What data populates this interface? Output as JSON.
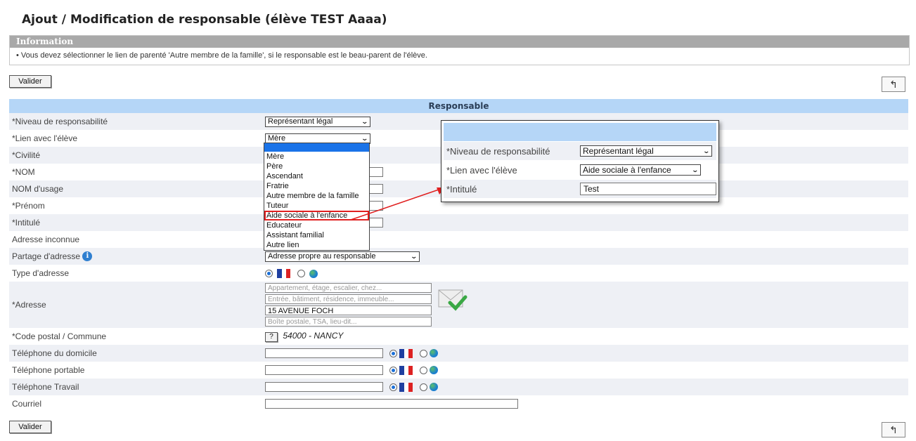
{
  "page": {
    "title": "Ajout / Modification de responsable (élève TEST Aaaa)"
  },
  "info": {
    "header": "Information",
    "text": "• Vous devez sélectionner le lien de parenté 'Autre membre de la famille', si le responsable est le beau-parent de l'élève."
  },
  "buttons": {
    "validate": "Valider",
    "back": "↰"
  },
  "form": {
    "header": "Responsable",
    "labels": {
      "niveau": "*Niveau de responsabilité",
      "lien": "*Lien avec l'élève",
      "civilite": "*Civilité",
      "nom": "*NOM",
      "nom_usage": "NOM d'usage",
      "prenom": "*Prénom",
      "intitule": "*Intitulé",
      "adresse_inconnue": "Adresse inconnue",
      "partage": "Partage d'adresse",
      "type_adresse": "Type d'adresse",
      "adresse": "*Adresse",
      "code_postal": "*Code postal / Commune",
      "tel_domicile": "Téléphone du domicile",
      "tel_portable": "Téléphone portable",
      "tel_travail": "Téléphone Travail",
      "courriel": "Courriel"
    },
    "niveau_value": "Représentant légal",
    "lien_value": "Mère",
    "partage_value": "Adresse propre au responsable",
    "address_placeholders": [
      "Appartement, étage, escalier, chez...",
      "Entrée, bâtiment, résidence, immeuble...",
      "",
      "Boîte postale, TSA, lieu-dit..."
    ],
    "address_line3": "15 AVENUE FOCH",
    "postal_button": "?",
    "postal_value": "54000 - NANCY"
  },
  "dropdown": {
    "options": [
      "",
      "Mère",
      "Père",
      "Ascendant",
      "Fratrie",
      "Autre membre de la famille",
      "Tuteur",
      "Aide sociale à l'enfance",
      "Educateur",
      "Assistant familial",
      "Autre lien"
    ],
    "highlighted": "Aide sociale à l'enfance"
  },
  "zoom": {
    "niveau_label": "*Niveau de responsabilité",
    "niveau_value": "Représentant légal",
    "lien_label": "*Lien avec l'élève",
    "lien_value": "Aide sociale à l'enfance",
    "intitule_label": "*Intitulé",
    "intitule_value": "Test"
  },
  "icons": {
    "info": "info-icon",
    "flag": "france-flag-icon",
    "globe": "globe-icon",
    "mail_check": "mail-check-icon",
    "back": "return-arrow-icon"
  },
  "colors": {
    "form_header_bg": "#b5d6f7",
    "info_header_bg": "#a9a9a9",
    "highlight_border": "#e02020",
    "selection_blue": "#1a73e8"
  }
}
